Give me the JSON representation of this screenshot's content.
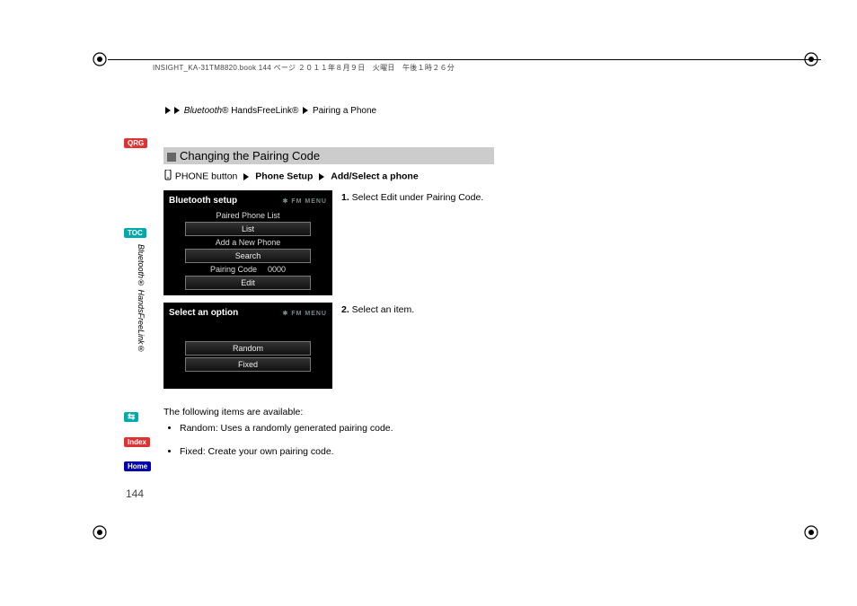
{
  "header_text": "INSIGHT_KA-31TM8820.book  144 ページ  ２０１１年８月９日　火曜日　午後１時２６分",
  "breadcrumb": {
    "part1_italic": "Bluetooth",
    "part1_rest": "® HandsFreeLink®",
    "part2": "Pairing a Phone"
  },
  "tabs": {
    "qrg": "QRG",
    "toc": "TOC",
    "pass": "⇆",
    "index": "Index",
    "home": "Home"
  },
  "vertical_label": "Bluetooth® HandsFreeLink®",
  "section_title": "Changing the Pairing Code",
  "nav": {
    "phone_button": "PHONE button",
    "step1": "Phone Setup",
    "step2": "Add/Select a phone"
  },
  "screen1": {
    "title": "Bluetooth setup",
    "bt_fm": "✱ FM    MENU",
    "row1_label": "Paired Phone List",
    "row1_btn": "List",
    "row2_label": "Add a New Phone",
    "row2_btn": "Search",
    "row3_label": "Pairing Code",
    "row3_code": "0000",
    "row3_btn": "Edit"
  },
  "screen2": {
    "title": "Select an option",
    "bt_fm": "✱ FM    MENU",
    "btn1": "Random",
    "btn2": "Fixed"
  },
  "steps": {
    "s1_num": "1.",
    "s1_a": " Select ",
    "s1_b": "Edit",
    "s1_c": " under ",
    "s1_d": "Pairing Code",
    "s1_e": ".",
    "s2_num": "2.",
    "s2_text": " Select an item."
  },
  "available": {
    "intro": "The following items are available:",
    "item1_b": "Random",
    "item1_t": ": Uses a randomly generated pairing code.",
    "item2_b": "Fixed",
    "item2_t": ": Create your own pairing code."
  },
  "page_number": "144"
}
